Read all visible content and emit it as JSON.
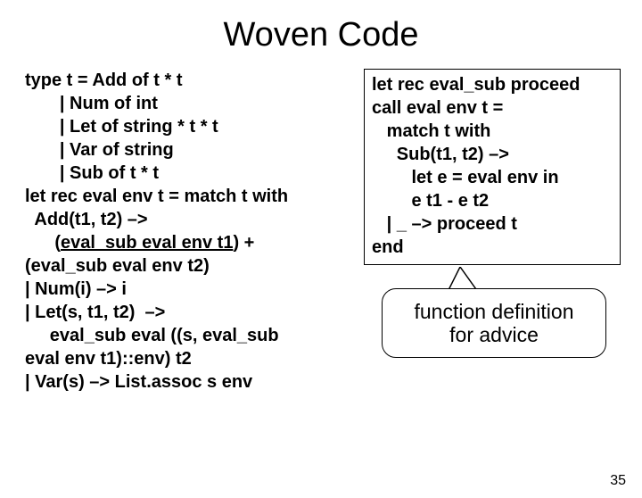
{
  "title": "Woven Code",
  "left": {
    "l1": "type t = Add of t * t",
    "l2": "       | Num of int",
    "l3": "       | Let of string * t * t",
    "l4": "       | Var of string",
    "l5": "       | Sub of t * t",
    "l6": "let rec eval env t = match t with",
    "l7": "  Add(t1, t2) –>",
    "l8a": "      (",
    "l8b": "eval_sub eval env t1",
    "l8c": ") +",
    "l9": "(eval_sub eval env t2)",
    "l10": "| Num(i) –> i",
    "l11": "| Let(s, t1, t2)  –>",
    "l12": "     eval_sub eval ((s, eval_sub",
    "l13": "eval env t1)::env) t2",
    "l14": "| Var(s) –> List.assoc s env"
  },
  "right": {
    "r1": "let rec eval_sub proceed",
    "r2": "call eval env t =",
    "r3": "   match t with",
    "r4": "     Sub(t1, t2) –>",
    "r5": "        let e = eval env in",
    "r6": "        e t1 - e t2",
    "r7": "   | _ –> proceed t",
    "r8": "end"
  },
  "callout": {
    "line1": "function definition",
    "line2": "for advice"
  },
  "page": "35"
}
